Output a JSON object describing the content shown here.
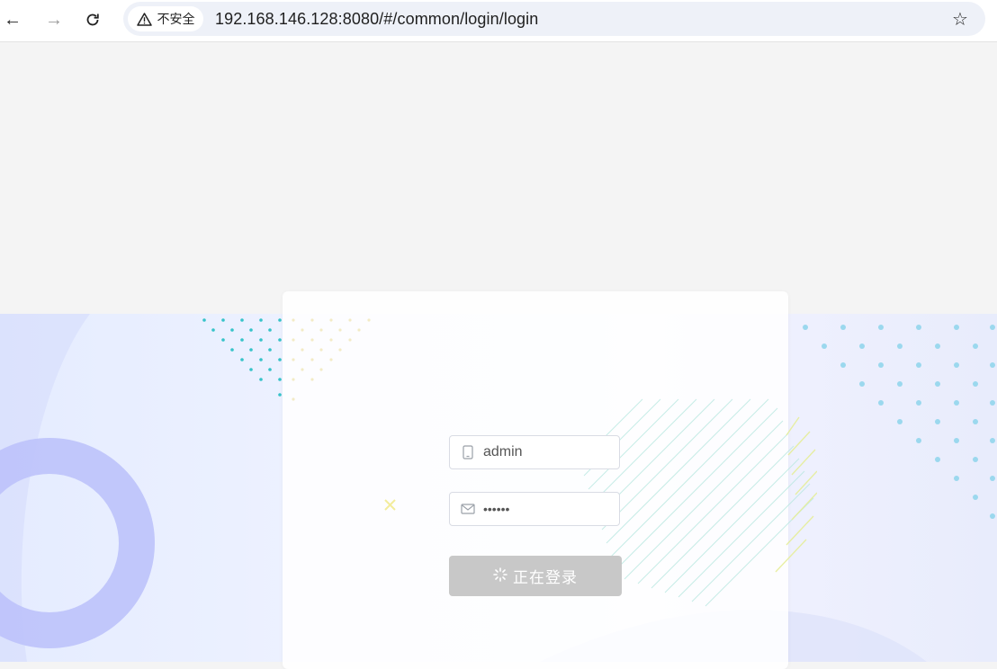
{
  "browser": {
    "back_icon": "arrow-left-icon",
    "forward_icon": "arrow-right-icon",
    "reload_icon": "reload-icon",
    "security_label": "不安全",
    "url": "192.168.146.128:8080/#/common/login/login",
    "bookmark_icon": "star-icon"
  },
  "login": {
    "username_value": "admin",
    "password_value": "••••••",
    "submit_label": "正在登录"
  },
  "colors": {
    "accent_ring": "#bcc2fb",
    "dot_teal": "#36c3c9",
    "dot_light_blue": "#9bd8ee",
    "button_loading": "#c8c8c8"
  }
}
